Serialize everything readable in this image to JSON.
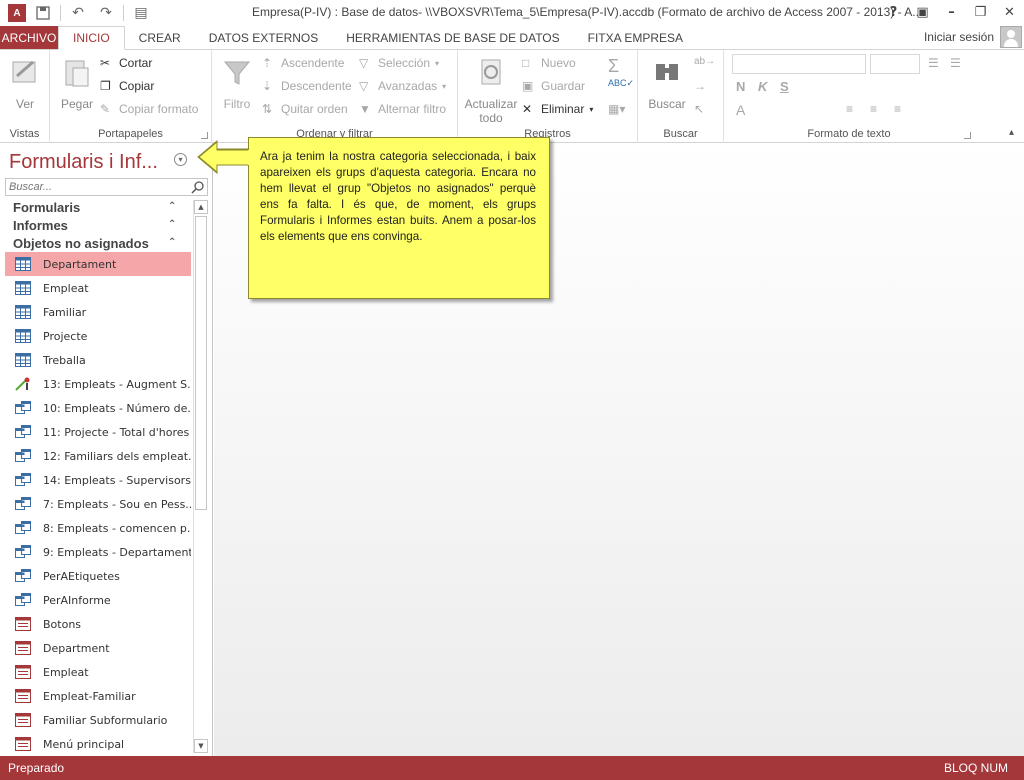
{
  "window": {
    "title": "Empresa(P-IV) : Base de datos- \\\\VBOXSVR\\Tema_5\\Empresa(P-IV).accdb (Formato de archivo de Access 2007 - 2013) - A...",
    "help": "?",
    "app_icon_label": "A"
  },
  "tabs": {
    "file": "ARCHIVO",
    "items": [
      "INICIO",
      "CREAR",
      "DATOS EXTERNOS",
      "HERRAMIENTAS DE BASE DE DATOS",
      "FITXA EMPRESA"
    ],
    "active": "INICIO",
    "signin": "Iniciar sesión"
  },
  "ribbon": {
    "vistas": {
      "label": "Vistas",
      "ver": "Ver"
    },
    "portapapeles": {
      "label": "Portapapeles",
      "pegar": "Pegar",
      "cortar": "Cortar",
      "copiar": "Copiar",
      "copiar_formato": "Copiar formato"
    },
    "ordenar": {
      "label": "Ordenar y filtrar",
      "filtro": "Filtro",
      "ascendente": "Ascendente",
      "descendente": "Descendente",
      "quitar_orden": "Quitar orden",
      "seleccion": "Selección",
      "avanzadas": "Avanzadas",
      "alternar_filtro": "Alternar filtro"
    },
    "registros": {
      "label": "Registros",
      "actualizar": "Actualizar",
      "todo": "todo",
      "nuevo": "Nuevo",
      "guardar": "Guardar",
      "eliminar": "Eliminar"
    },
    "buscar": {
      "label": "Buscar",
      "buscar": "Buscar"
    },
    "formato": {
      "label": "Formato de texto",
      "bold": "N",
      "italic": "K",
      "underline": "S",
      "font_a": "A"
    }
  },
  "navpane": {
    "title": "Formularis i Inf...",
    "search_placeholder": "Buscar...",
    "groups": [
      "Formularis",
      "Informes",
      "Objetos no asignados"
    ],
    "items": [
      {
        "label": "Departament",
        "type": "table",
        "selected": true
      },
      {
        "label": "Empleat",
        "type": "table"
      },
      {
        "label": "Familiar",
        "type": "table"
      },
      {
        "label": "Projecte",
        "type": "table"
      },
      {
        "label": "Treballa",
        "type": "table"
      },
      {
        "label": "13: Empleats - Augment S...",
        "type": "update-query"
      },
      {
        "label": "10: Empleats - Número de...",
        "type": "query"
      },
      {
        "label": "11: Projecte - Total d'hores",
        "type": "query"
      },
      {
        "label": "12: Familiars dels empleat...",
        "type": "query"
      },
      {
        "label": "14: Empleats - Supervisors",
        "type": "query"
      },
      {
        "label": "7: Empleats - Sou en Pess...",
        "type": "query"
      },
      {
        "label": "8: Empleats - comencen p...",
        "type": "query"
      },
      {
        "label": "9: Empleats - Departaments",
        "type": "query"
      },
      {
        "label": "PerAEtiquetes",
        "type": "query"
      },
      {
        "label": "PerAInforme",
        "type": "query"
      },
      {
        "label": "Botons",
        "type": "form"
      },
      {
        "label": "Department",
        "type": "form"
      },
      {
        "label": "Empleat",
        "type": "form"
      },
      {
        "label": "Empleat-Familiar",
        "type": "form"
      },
      {
        "label": "Familiar Subformulario",
        "type": "form"
      },
      {
        "label": "Menú principal",
        "type": "form"
      }
    ]
  },
  "callout": {
    "text": "Ara ja tenim la nostra categoria seleccionada, i baix apareixen els grups d'aquesta categoria. Encara no hem llevat el grup \"Objetos no asignados\" perquè ens fa falta. I és que, de moment, els grups Formularis i Informes estan buits. Anem a posar-los els elements que ens convinga."
  },
  "status": {
    "left": "Preparado",
    "right": "BLOQ NUM"
  },
  "colors": {
    "accent": "#a4373a",
    "selection": "#f4a6a8",
    "callout": "#ffff66"
  }
}
